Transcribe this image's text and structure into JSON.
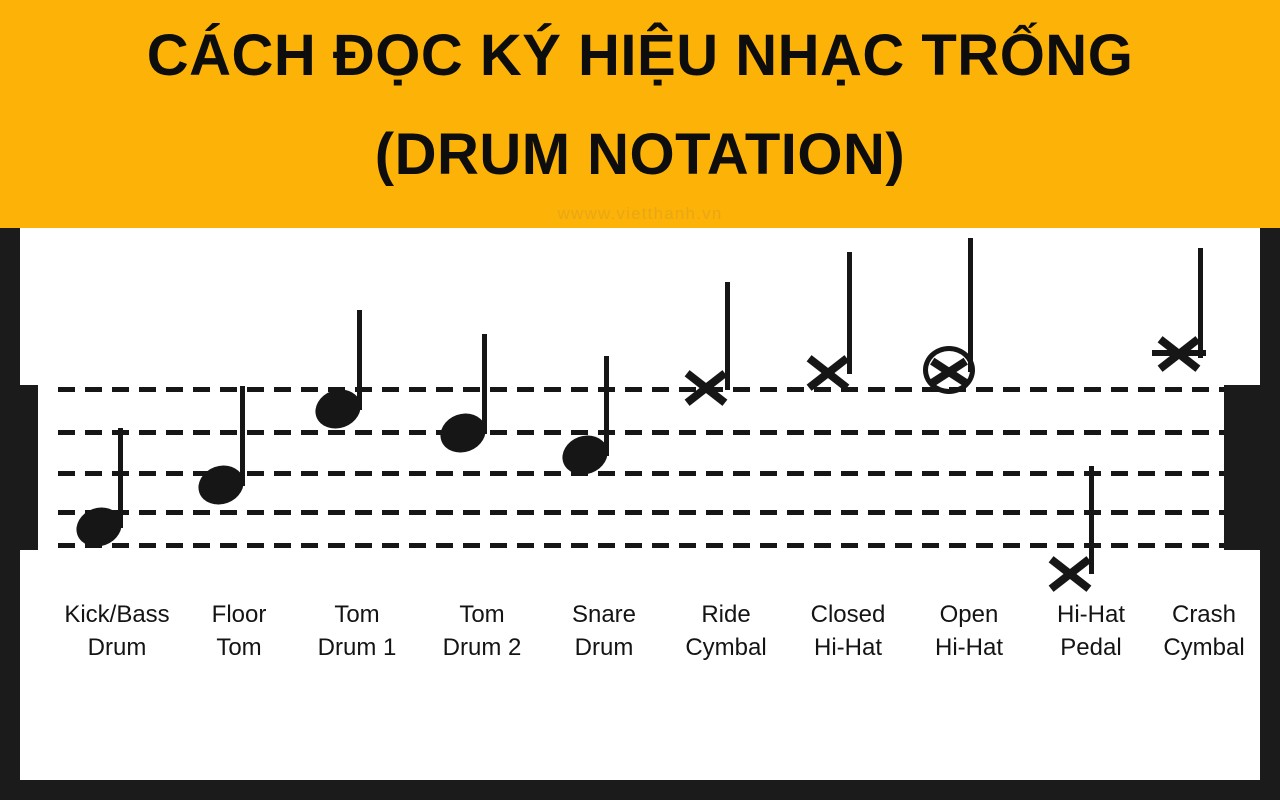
{
  "header": {
    "title_line1": "CÁCH ĐỌC KÝ HIỆU NHẠC TRỐNG",
    "title_line2": "(DRUM NOTATION)",
    "watermark": "wwww.vietthanh.vn",
    "background_color": "#fcb206",
    "text_color": "#0d0d0d"
  },
  "panel": {
    "background_color": "#ffffff",
    "border_color": "#1b1b1b"
  },
  "staff": {
    "line_count": 5,
    "line_style": "dashed",
    "line_color": "#161616",
    "barline_color": "#1b1b1b"
  },
  "instruments": [
    {
      "id": "kick-bass-drum",
      "label_line1": "Kick/Bass",
      "label_line2": "Drum",
      "notehead": "filled-oval",
      "staff_position": "bottom-space",
      "stem_direction": "up"
    },
    {
      "id": "floor-tom",
      "label_line1": "Floor",
      "label_line2": "Tom",
      "notehead": "filled-oval",
      "staff_position": "second-space-from-bottom",
      "stem_direction": "up"
    },
    {
      "id": "tom-drum-1",
      "label_line1": "Tom",
      "label_line2": "Drum 1",
      "notehead": "filled-oval",
      "staff_position": "top-space",
      "stem_direction": "up"
    },
    {
      "id": "tom-drum-2",
      "label_line1": "Tom",
      "label_line2": "Drum 2",
      "notehead": "filled-oval",
      "staff_position": "second-line-from-top",
      "stem_direction": "up"
    },
    {
      "id": "snare-drum",
      "label_line1": "Snare",
      "label_line2": "Drum",
      "notehead": "filled-oval",
      "staff_position": "middle-space",
      "stem_direction": "up"
    },
    {
      "id": "ride-cymbal",
      "label_line1": "Ride",
      "label_line2": "Cymbal",
      "notehead": "x",
      "staff_position": "top-line",
      "stem_direction": "up"
    },
    {
      "id": "closed-hi-hat",
      "label_line1": "Closed",
      "label_line2": "Hi-Hat",
      "notehead": "x",
      "staff_position": "above-top-line",
      "stem_direction": "up"
    },
    {
      "id": "open-hi-hat",
      "label_line1": "Open",
      "label_line2": "Hi-Hat",
      "notehead": "circled-x",
      "staff_position": "above-top-line",
      "stem_direction": "up"
    },
    {
      "id": "hi-hat-pedal",
      "label_line1": "Hi-Hat",
      "label_line2": "Pedal",
      "notehead": "x",
      "staff_position": "below-bottom-line",
      "stem_direction": "up"
    },
    {
      "id": "crash-cymbal",
      "label_line1": "Crash",
      "label_line2": "Cymbal",
      "notehead": "x-with-line",
      "staff_position": "above-top-line",
      "stem_direction": "up"
    }
  ]
}
